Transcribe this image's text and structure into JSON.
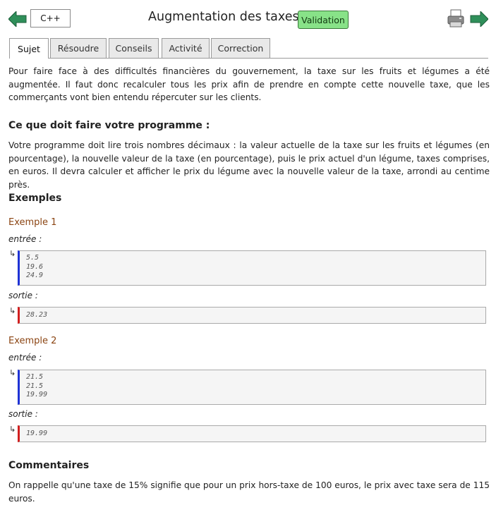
{
  "header": {
    "language": "C++",
    "title": "Augmentation des taxes",
    "badge": "Validation",
    "accent_green": "#2e8b57"
  },
  "tabs": [
    "Sujet",
    "Résoudre",
    "Conseils",
    "Activité",
    "Correction"
  ],
  "active_tab": "Sujet",
  "intro": "Pour faire face à des difficultés financières du gouvernement, la taxe sur les fruits et légumes a été augmentée. Il faut donc recalculer tous les prix afin de prendre en compte cette nouvelle taxe, que les commerçants vont bien entendu répercuter sur les clients.",
  "task": {
    "heading": "Ce que doit faire votre programme :",
    "text": "Votre programme doit lire trois nombres décimaux : la valeur actuelle de la taxe sur les fruits et légumes (en pourcentage), la nouvelle valeur de la taxe (en pourcentage), puis le prix actuel d'un légume, taxes comprises, en euros. Il devra calculer et afficher le prix du légume avec la nouvelle valeur de la taxe, arrondi au centime près."
  },
  "examples_heading": "Exemples",
  "examples": [
    {
      "title": "Exemple 1",
      "input_label": "entrée :",
      "input": [
        "5.5",
        "19.6",
        "24.9"
      ],
      "output_label": "sortie :",
      "output": [
        "28.23"
      ]
    },
    {
      "title": "Exemple 2",
      "input_label": "entrée :",
      "input": [
        "21.5",
        "21.5",
        "19.99"
      ],
      "output_label": "sortie :",
      "output": [
        "19.99"
      ]
    }
  ],
  "comments": {
    "heading": "Commentaires",
    "text": "On rappelle qu'une taxe de 15% signifie que pour un prix hors-taxe de 100 euros, le prix avec taxe sera de 115 euros."
  },
  "icons": {
    "back": "arrow-left-icon",
    "forward": "arrow-right-icon",
    "print": "printer-icon",
    "return": "return-arrow-icon"
  },
  "colors": {
    "input_bar": "#1f33d6",
    "output_bar": "#d21f1f",
    "example_title": "#8b4513",
    "badge_bg": "#88e288"
  }
}
